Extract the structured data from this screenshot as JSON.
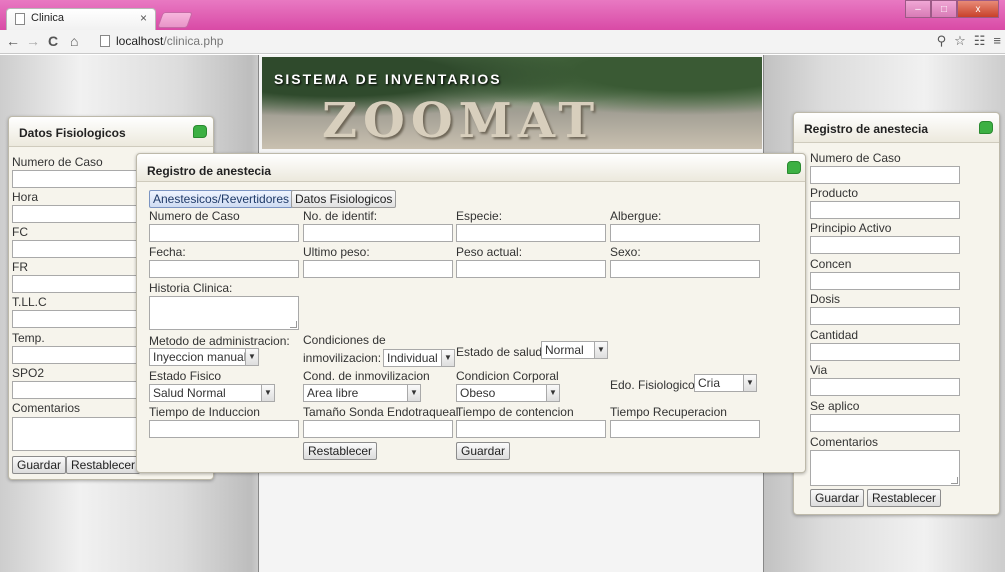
{
  "browser": {
    "tab_title": "Clinica",
    "tab_close": "×",
    "url_host": "localhost",
    "url_path": "/clinica.php",
    "back": "←",
    "forward": "→",
    "reload": "C",
    "home": "⌂",
    "win_minimize": "–",
    "win_maximize": "□",
    "win_close": "x"
  },
  "banner": {
    "title": "SISTEMA DE INVENTARIOS",
    "sign": "ZOOMAT"
  },
  "left_panel": {
    "title": "Datos Fisiologicos",
    "fields": [
      "Numero de Caso",
      "Hora",
      "FC",
      "FR",
      "T.LL.C",
      "Temp.",
      "SPO2"
    ],
    "comments_label": "Comentarios",
    "save": "Guardar",
    "reset": "Restablecer"
  },
  "right_panel": {
    "title": "Registro de anestecia",
    "fields": [
      "Numero de Caso",
      "Producto",
      "Principio Activo",
      "Concen",
      "Dosis",
      "Cantidad",
      "Via",
      "Se aplico"
    ],
    "comments_label": "Comentarios",
    "save": "Guardar",
    "reset": "Restablecer"
  },
  "main_panel": {
    "title": "Registro de anestecia",
    "tabs": [
      "Anestesicos/Revertidores",
      "Datos Fisiologicos"
    ],
    "row1": [
      "Numero de Caso",
      "No. de identif:",
      "Especie:",
      "Albergue:"
    ],
    "row2": [
      "Fecha:",
      "Ultimo peso:",
      "Peso actual:",
      "Sexo:"
    ],
    "historia_label": "Historia Clinica:",
    "metodo_label": "Metodo de administracion:",
    "metodo_value": "Inyeccion manual",
    "condiciones_label_1": "Condiciones de",
    "condiciones_label_2": "inmovilizacion:",
    "condiciones_value": "Individual",
    "estado_salud_label": "Estado de salud:",
    "estado_salud_value": "Normal",
    "estado_fisico_label": "Estado Fisico",
    "estado_fisico_value": "Salud Normal",
    "cond_inmov_label": "Cond. de inmovilizacion",
    "cond_inmov_value": "Area libre",
    "condicion_corporal_label": "Condicion Corporal",
    "condicion_corporal_value": "Obeso",
    "edo_fisiologico_label": "Edo. Fisiologico",
    "edo_fisiologico_value": "Cria",
    "row_times": [
      "Tiempo de Induccion",
      "Tamaño Sonda Endotraqueal",
      "Tiempo de contencion",
      "Tiempo Recuperacion"
    ],
    "reset": "Restablecer",
    "save": "Guardar"
  },
  "colors": {
    "accent_green": "#3cb043",
    "tabstrip_pink": "#d94aa6",
    "panel_bg": "#f6f4ec"
  }
}
